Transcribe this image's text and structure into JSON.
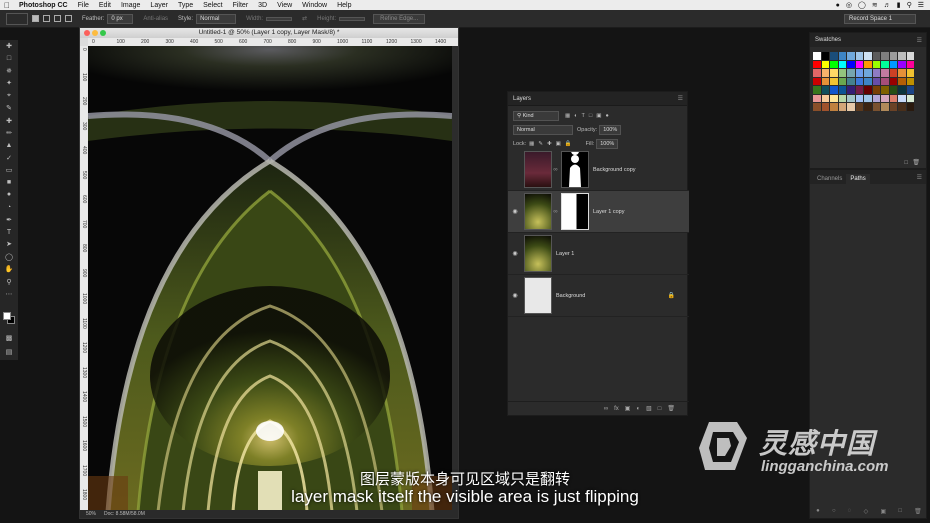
{
  "menubar": {
    "app_name": "Photoshop CC",
    "items": [
      "File",
      "Edit",
      "Image",
      "Layer",
      "Type",
      "Select",
      "Filter",
      "3D",
      "View",
      "Window",
      "Help"
    ]
  },
  "options": {
    "feather_label": "Feather:",
    "feather_value": "0 px",
    "antialias_label": "Anti-alias",
    "style_label": "Style:",
    "style_value": "Normal",
    "width_label": "Width:",
    "height_label": "Height:",
    "refine_edge": "Refine Edge...",
    "workspace": "Record Space 1"
  },
  "document": {
    "title": "Untitled-1 @ 50% (Layer 1 copy, Layer Mask/8) *",
    "ruler_h_ticks": [
      "0",
      "100",
      "200",
      "300",
      "400",
      "500",
      "600",
      "700",
      "800",
      "900",
      "1000",
      "1100",
      "1200",
      "1300",
      "1400"
    ],
    "ruler_v_ticks": [
      "0",
      "100",
      "200",
      "300",
      "400",
      "500",
      "600",
      "700",
      "800",
      "900",
      "1000",
      "1100",
      "1200",
      "1300",
      "1400",
      "1500",
      "1600",
      "1700",
      "1800"
    ],
    "zoom": "50%",
    "doc_info": "Doc: 8.58M/58.0M"
  },
  "layers_panel": {
    "title": "Layers",
    "filter_kind": "Kind",
    "blend_mode": "Normal",
    "opacity_label": "Opacity:",
    "opacity_value": "100%",
    "lock_label": "Lock:",
    "fill_label": "Fill:",
    "fill_value": "100%",
    "layers": [
      {
        "name": "Background copy",
        "visible": false,
        "selected": false,
        "has_mask": true
      },
      {
        "name": "Layer 1 copy",
        "visible": true,
        "selected": true,
        "has_mask": true
      },
      {
        "name": "Layer 1",
        "visible": true,
        "selected": false,
        "has_mask": false
      },
      {
        "name": "Background",
        "visible": true,
        "selected": false,
        "has_mask": false,
        "locked": true
      }
    ]
  },
  "swatches_panel": {
    "title": "Swatches",
    "colors": [
      "#ffffff",
      "#000000",
      "#1a4d7a",
      "#3d85c6",
      "#6fa8dc",
      "#9fc5e8",
      "#cfe2f3",
      "#5b5b5b",
      "#7f7f7f",
      "#9c9c9c",
      "#bdbdbd",
      "#d9d9d9",
      "#ff0000",
      "#ffff00",
      "#00ff00",
      "#00ffff",
      "#0000ff",
      "#ff00ff",
      "#ff9900",
      "#99ff00",
      "#00ff99",
      "#0099ff",
      "#9900ff",
      "#ff0099",
      "#e06666",
      "#f6b26b",
      "#ffd966",
      "#93c47d",
      "#76a5af",
      "#6d9eeb",
      "#6fa8dc",
      "#8e7cc3",
      "#c27ba0",
      "#cc4125",
      "#e69138",
      "#f1c232",
      "#cc0000",
      "#e69138",
      "#f1c232",
      "#6aa84f",
      "#45818e",
      "#3c78d8",
      "#3d85c6",
      "#674ea7",
      "#a64d79",
      "#990000",
      "#b45f06",
      "#bf9000",
      "#38761d",
      "#134f5c",
      "#1155cc",
      "#0b5394",
      "#351c75",
      "#741b47",
      "#660000",
      "#783f04",
      "#7f6000",
      "#274e13",
      "#0c343d",
      "#1c4587",
      "#ea9999",
      "#f9cb9c",
      "#ffe599",
      "#b6d7a8",
      "#a2c4c9",
      "#a4c2f4",
      "#9fc5e8",
      "#b4a7d6",
      "#d5a6bd",
      "#dd7e6b",
      "#c9daf8",
      "#d9ead3",
      "#8a4f2a",
      "#a0522d",
      "#c0813f",
      "#d2a679",
      "#e6c9a8",
      "#5c3a1e",
      "#3b2412",
      "#7a5230",
      "#b08a5a",
      "#6b4226",
      "#4a2f1a",
      "#2a1a0e"
    ]
  },
  "channels_paths": {
    "tabs": [
      "Channels",
      "Paths"
    ],
    "active": "Paths"
  },
  "subtitles": {
    "chinese": "图层蒙版本身可见区域只是翻转",
    "english": "layer mask itself the visible area is just flipping"
  },
  "watermark": {
    "cn": "灵感中国",
    "en": "lingganchina.com"
  }
}
